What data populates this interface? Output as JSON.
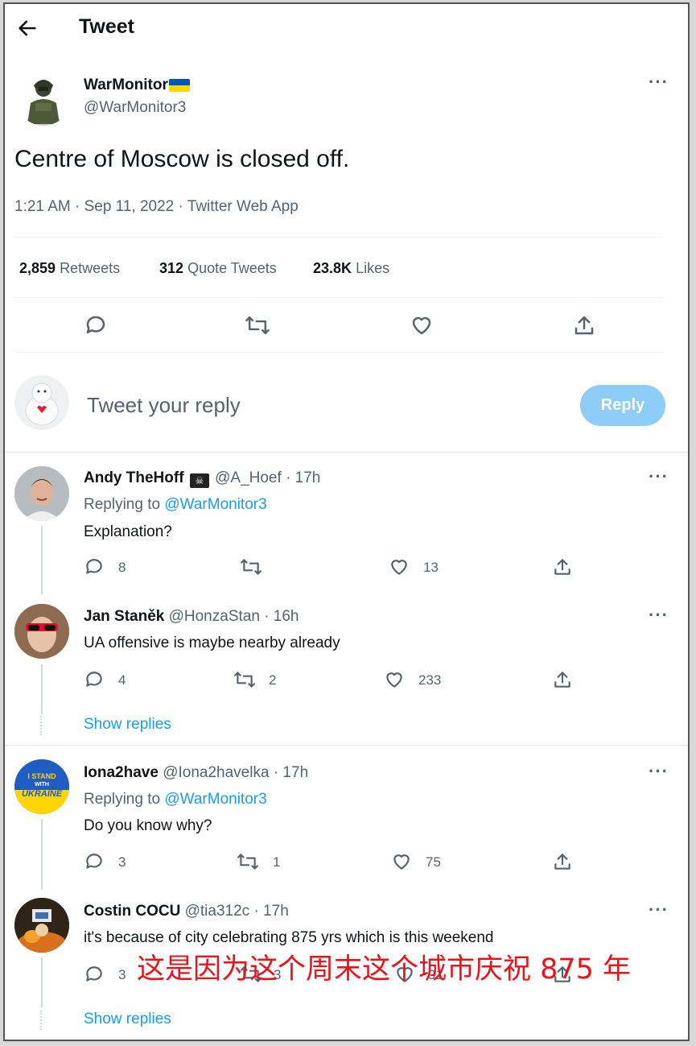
{
  "header": {
    "title": "Tweet"
  },
  "tweet": {
    "author_name": "WarMonitor",
    "author_handle": "@WarMonitor3",
    "text": "Centre of Moscow is closed off.",
    "meta": "1:21 AM · Sep 11, 2022 · Twitter Web App",
    "stats": {
      "retweets_count": "2,859",
      "retweets_label": "Retweets",
      "quotes_count": "312",
      "quotes_label": "Quote Tweets",
      "likes_count": "23.8K",
      "likes_label": "Likes"
    }
  },
  "composer": {
    "placeholder": "Tweet your reply",
    "button": "Reply"
  },
  "replies": [
    {
      "name": "Andy TheHoff",
      "handle": "@A_Hoef",
      "time": "· 17h",
      "replying_label": "Replying to",
      "replying_to": "@WarMonitor3",
      "text": "Explanation?",
      "reply_count": "8",
      "retweet_count": "",
      "like_count": "13"
    },
    {
      "name": "Jan Staněk",
      "handle": "@HonzaStan",
      "time": "· 16h",
      "text": "UA offensive is maybe nearby already",
      "reply_count": "4",
      "retweet_count": "2",
      "like_count": "233",
      "show_replies": "Show replies"
    },
    {
      "name": "Iona2have",
      "handle": "@Iona2havelka",
      "time": "· 17h",
      "replying_label": "Replying to",
      "replying_to": "@WarMonitor3",
      "text": "Do you know why?",
      "reply_count": "3",
      "retweet_count": "1",
      "like_count": "75",
      "avatar_text": "I STAND WITH UKRAINE"
    },
    {
      "name": "Costin COCU",
      "handle": "@tia312c",
      "time": "· 17h",
      "text": "it's because of city celebrating 875 yrs which is this weekend",
      "reply_count": "3",
      "retweet_count": "3",
      "like_count": "91",
      "show_replies": "Show replies"
    }
  ],
  "overlay_caption": "这是因为这个周末这个城市庆祝 875 年",
  "colors": {
    "accent": "#1d9bf0",
    "reply_button_disabled": "#8ecdf8",
    "overlay_red": "#e8141c",
    "flag_blue": "#0057b7",
    "flag_yellow": "#ffd700"
  }
}
